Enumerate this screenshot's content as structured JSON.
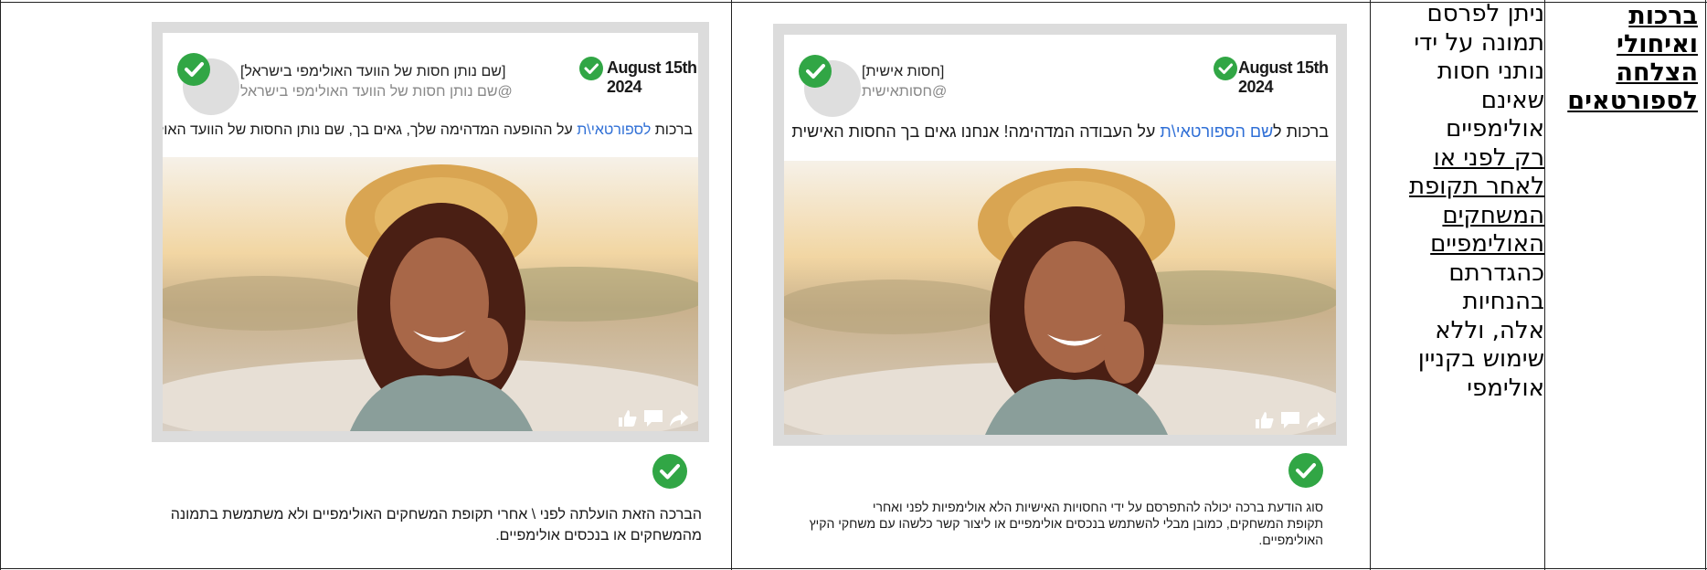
{
  "title": {
    "lines": [
      "ברכות",
      "ואיחולי",
      "הצלחה",
      "לספורטאים"
    ]
  },
  "rule": {
    "lines_plain_top": [
      "ניתן לפרסם",
      "תמונה על ידי",
      "נותני חסות",
      "שאינם",
      "אולימפיים"
    ],
    "lines_underlined": [
      "רק לפני או",
      "לאחר תקופת",
      "המשחקים",
      "האולימפיים"
    ],
    "lines_plain_bottom": [
      "כהגדרתם",
      "בהנחיות",
      "אלה, וללא",
      "שימוש בקניין",
      "אולימפי"
    ]
  },
  "examples": [
    {
      "date": "August 15th 2024",
      "name": "[חסות אישית]",
      "handle": "@חסותאישית",
      "post_prefix": "ברכות ל",
      "post_highlight": "שם הספורטאי\\ת",
      "post_suffix": " על העבודה המדהימה! אנחנו גאים בך החסות האישית",
      "caption_lines": [
        "סוג הודעת ברכה יכולה להתפרסם על ידי החסויות האישיות הלא אולימפיות לפני ואחרי",
        "תקופת המשחקים, כמובן מבלי להשתמש בנכסים אולימפיים או ליצור קשר כלשהו עם משחקי הקיץ",
        "האולימפיים."
      ]
    },
    {
      "date": "August 15th 2024",
      "name": "[שם נותן חסות של הוועד האולימפי בישראל]",
      "handle": "@שם נותן חסות של הוועד האולימפי בישראל",
      "post_prefix": "ברכות ",
      "post_highlight": "לספורטאי\\ת",
      "post_suffix": " על ההופעה המדהימה שלך, גאים בך, שם נותן החסות של הוועד האולימפי בישראל",
      "caption_lines": [
        "הברכה הזאת הועלתה לפני \\ אחרי תקופת המשחקים האולימפיים ולא משתמשת בתמונה",
        "מהמשחקים או בנכסים אולימפיים."
      ]
    }
  ],
  "icons": {
    "check": "check-circle-icon",
    "like": "thumbs-up-icon",
    "comment": "comment-icon",
    "share": "share-icon"
  },
  "colors": {
    "check_green": "#31a645",
    "link_blue": "#2f6fd6",
    "card_border": "#dcdcdc"
  }
}
